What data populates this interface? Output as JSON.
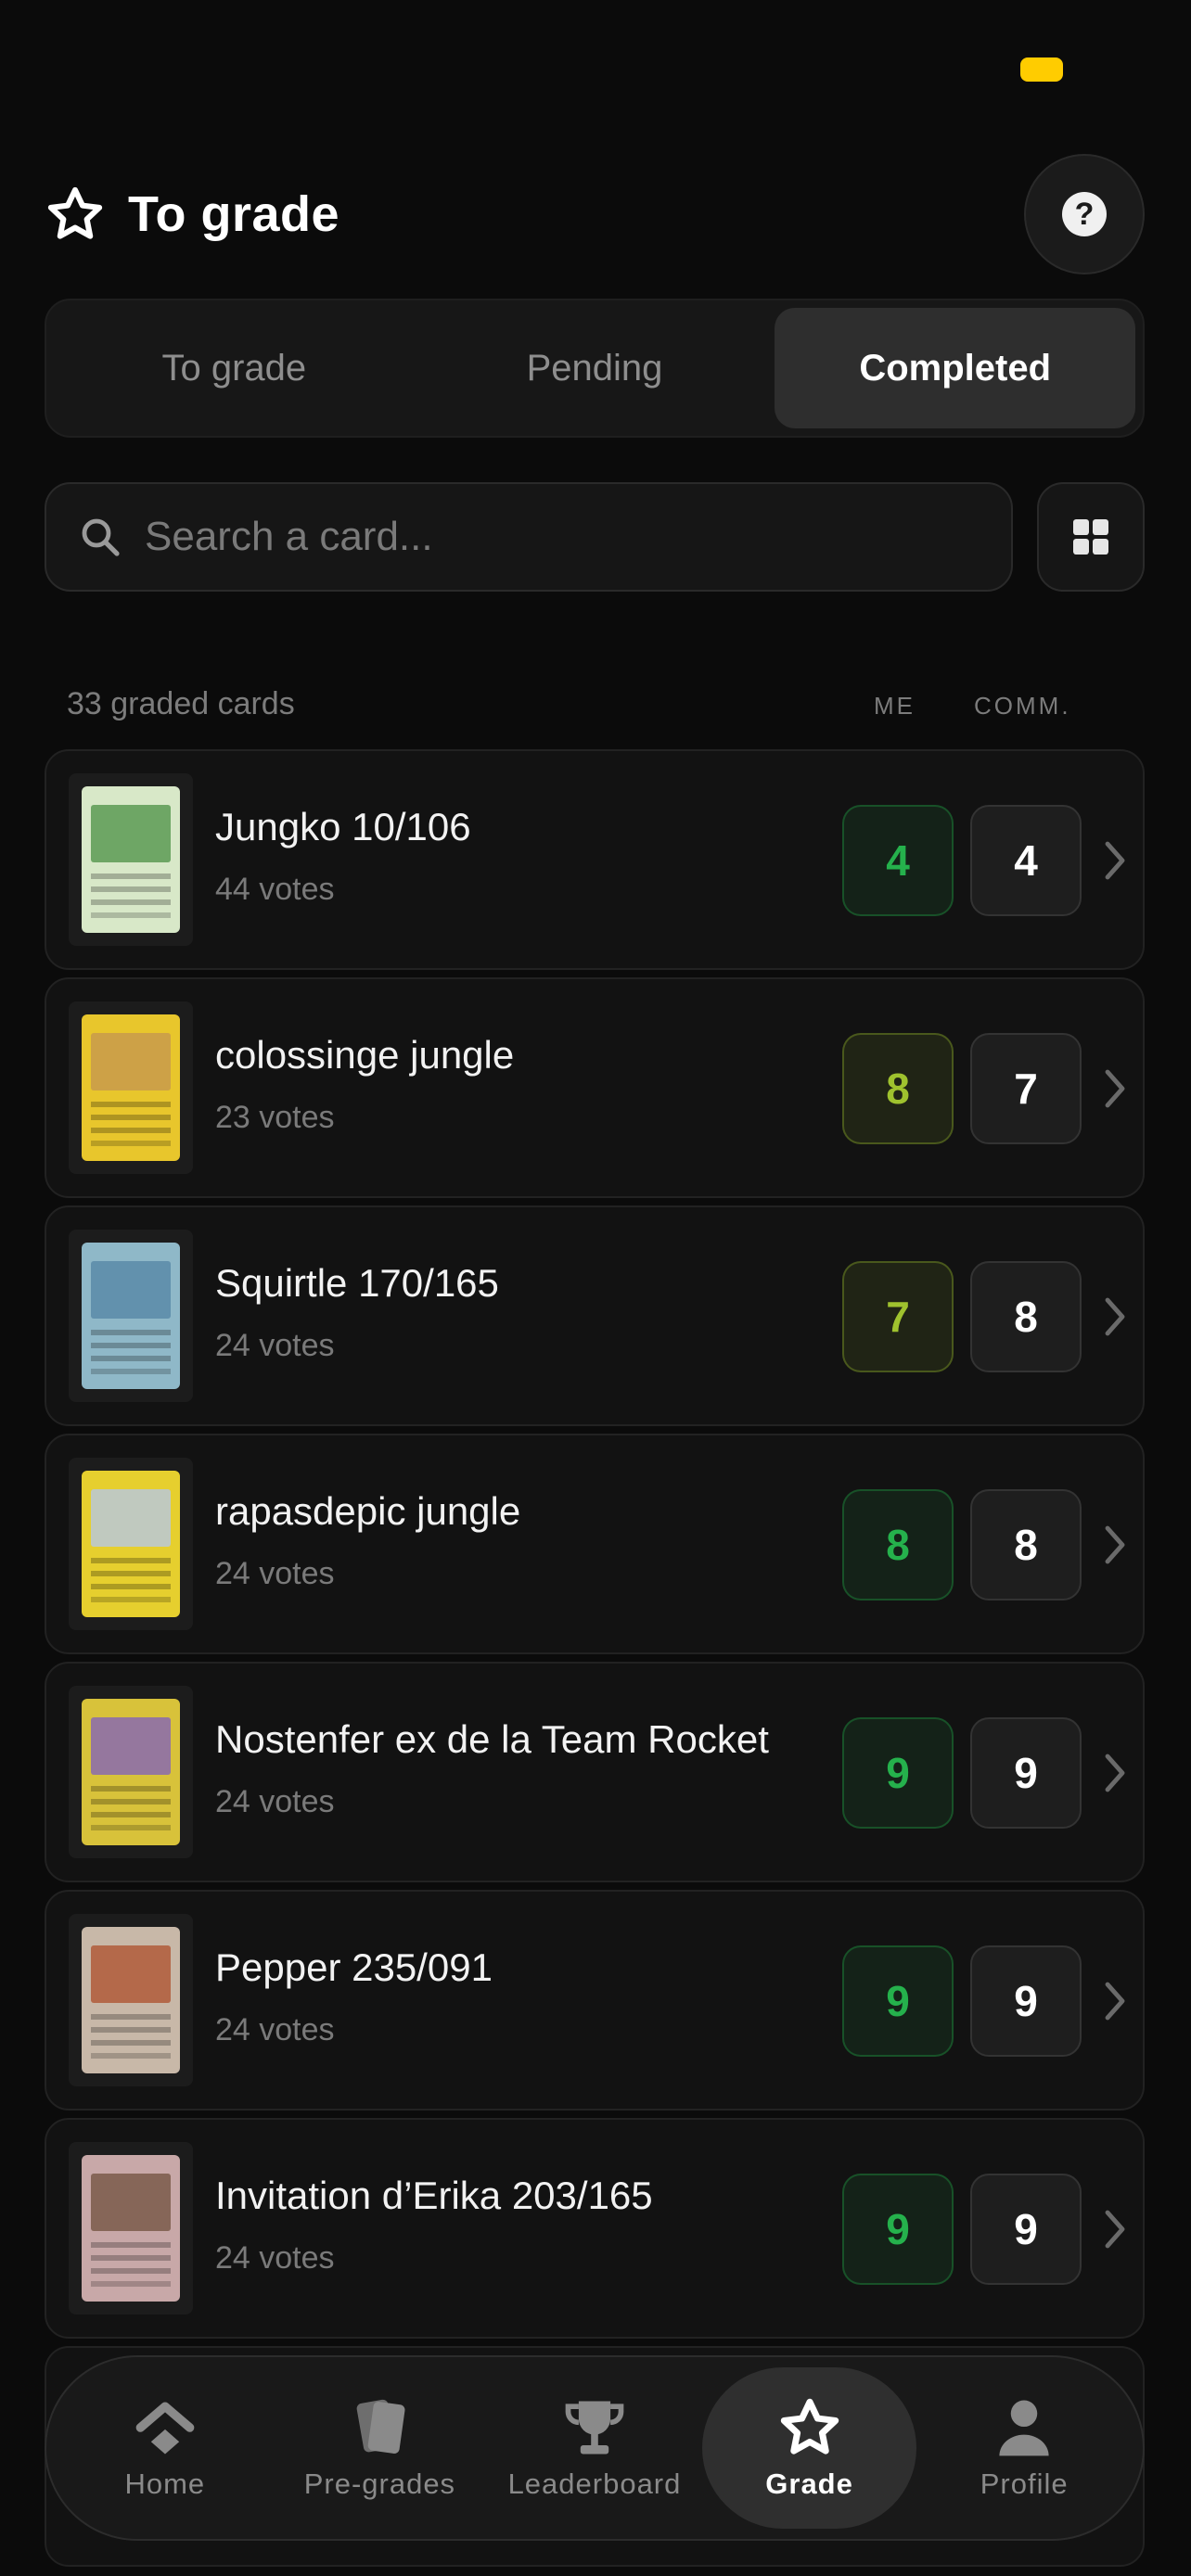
{
  "header": {
    "title": "To grade",
    "title_icon": "star-outline-icon",
    "help_label": "?"
  },
  "segments": [
    {
      "label": "To grade",
      "active": false
    },
    {
      "label": "Pending",
      "active": false
    },
    {
      "label": "Completed",
      "active": true
    }
  ],
  "search": {
    "placeholder": "Search a card...",
    "value": ""
  },
  "list": {
    "count_label": "33 graded cards",
    "col_me": "ME",
    "col_comm": "COMM."
  },
  "cards": [
    {
      "name": "Jungko 10/106",
      "votes": "44 votes",
      "me": "4",
      "comm": "4",
      "me_color": "#25b14c",
      "art": "#d8e8c8",
      "win": "#5c9a54"
    },
    {
      "name": "colossinge jungle",
      "votes": "23 votes",
      "me": "8",
      "comm": "7",
      "me_color": "#9fc22e",
      "art": "#e8c62c",
      "win": "#c89a4c"
    },
    {
      "name": "Squirtle 170/165",
      "votes": "24 votes",
      "me": "7",
      "comm": "8",
      "me_color": "#9fc22e",
      "art": "#8fb8c8",
      "win": "#5a8aa8"
    },
    {
      "name": "rapasdepic jungle",
      "votes": "24 votes",
      "me": "8",
      "comm": "8",
      "me_color": "#25b14c",
      "art": "#e6cf2e",
      "win": "#b8c8d8"
    },
    {
      "name": "Nostenfer ex de la Team Rocket",
      "votes": "24 votes",
      "me": "9",
      "comm": "9",
      "me_color": "#25b14c",
      "art": "#d8c23a",
      "win": "#8a6ab0"
    },
    {
      "name": "Pepper 235/091",
      "votes": "24 votes",
      "me": "9",
      "comm": "9",
      "me_color": "#25b14c",
      "art": "#c8b8a8",
      "win": "#b05a3a"
    },
    {
      "name": "Invitation d’Erika 203/165",
      "votes": "24 votes",
      "me": "9",
      "comm": "9",
      "me_color": "#25b14c",
      "art": "#c8a8a8",
      "win": "#7a5a4a"
    }
  ],
  "tabbar": [
    {
      "label": "Home",
      "icon": "home-icon",
      "active": false
    },
    {
      "label": "Pre-grades",
      "icon": "cards-icon",
      "active": false
    },
    {
      "label": "Leaderboard",
      "icon": "trophy-icon",
      "active": false
    },
    {
      "label": "Grade",
      "icon": "star-icon",
      "active": true
    },
    {
      "label": "Profile",
      "icon": "person-icon",
      "active": false
    }
  ],
  "colors": {
    "accent_green": "#25b14c",
    "accent_lime": "#9fc22e",
    "status_pill": "#ffcc00"
  }
}
